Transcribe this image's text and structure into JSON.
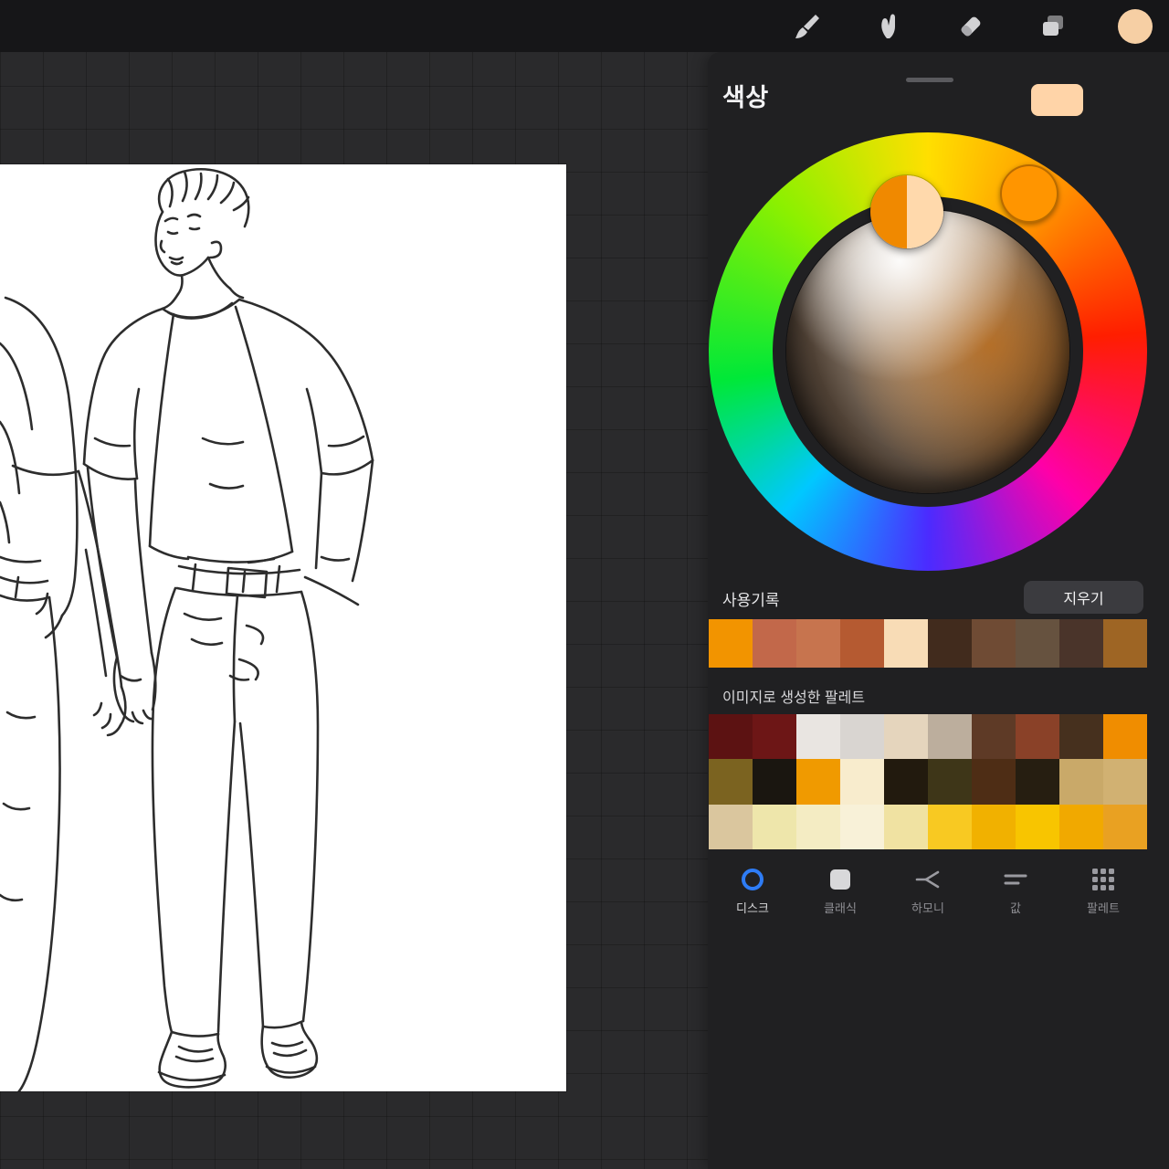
{
  "toolbar": {
    "icons": [
      {
        "name": "brush-icon"
      },
      {
        "name": "smudge-icon"
      },
      {
        "name": "eraser-icon"
      },
      {
        "name": "layers-icon"
      }
    ],
    "current_color": "#f6cfa4"
  },
  "color_panel": {
    "title": "색상",
    "top_swatch_color": "#ffd4a8",
    "wheel": {
      "ring_selector_color": "#ff9500",
      "disc_selector_left": "#f08900",
      "disc_selector_right": "#ffd9ac"
    },
    "history": {
      "label": "사용기록",
      "clear_button": "지우기",
      "colors": [
        "#f29400",
        "#c2684a",
        "#c7744e",
        "#b55a31",
        "#f8dcb6",
        "#412b1d",
        "#6f4b34",
        "#66523f",
        "#4a342a",
        "#9e6524"
      ]
    },
    "image_palette": {
      "label": "이미지로 생성한 팔레트",
      "rows": [
        [
          "#5c1212",
          "#6d1616",
          "#e9e5e1",
          "#d9d5d1",
          "#e5d5bd",
          "#bcae9d",
          "#5e3a26",
          "#8a4128",
          "#46301e",
          "#f08d00"
        ],
        [
          "#7b6320",
          "#1a1610",
          "#f09a00",
          "#f8eccd",
          "#221a0e",
          "#3e3618",
          "#4e2d15",
          "#261e11",
          "#c9a969",
          "#d1b172"
        ],
        [
          "#dac69e",
          "#eee6ab",
          "#f4ecc3",
          "#f8f1d8",
          "#f0e2a2",
          "#f8c922",
          "#f1b100",
          "#f8c500",
          "#f1a900",
          "#e9a122"
        ]
      ]
    },
    "tabs": [
      {
        "label": "디스크",
        "selected": true
      },
      {
        "label": "클래식",
        "selected": false
      },
      {
        "label": "하모니",
        "selected": false
      },
      {
        "label": "값",
        "selected": false
      },
      {
        "label": "팔레트",
        "selected": false
      }
    ]
  },
  "accent": {
    "blue": "#2e7cf5"
  }
}
